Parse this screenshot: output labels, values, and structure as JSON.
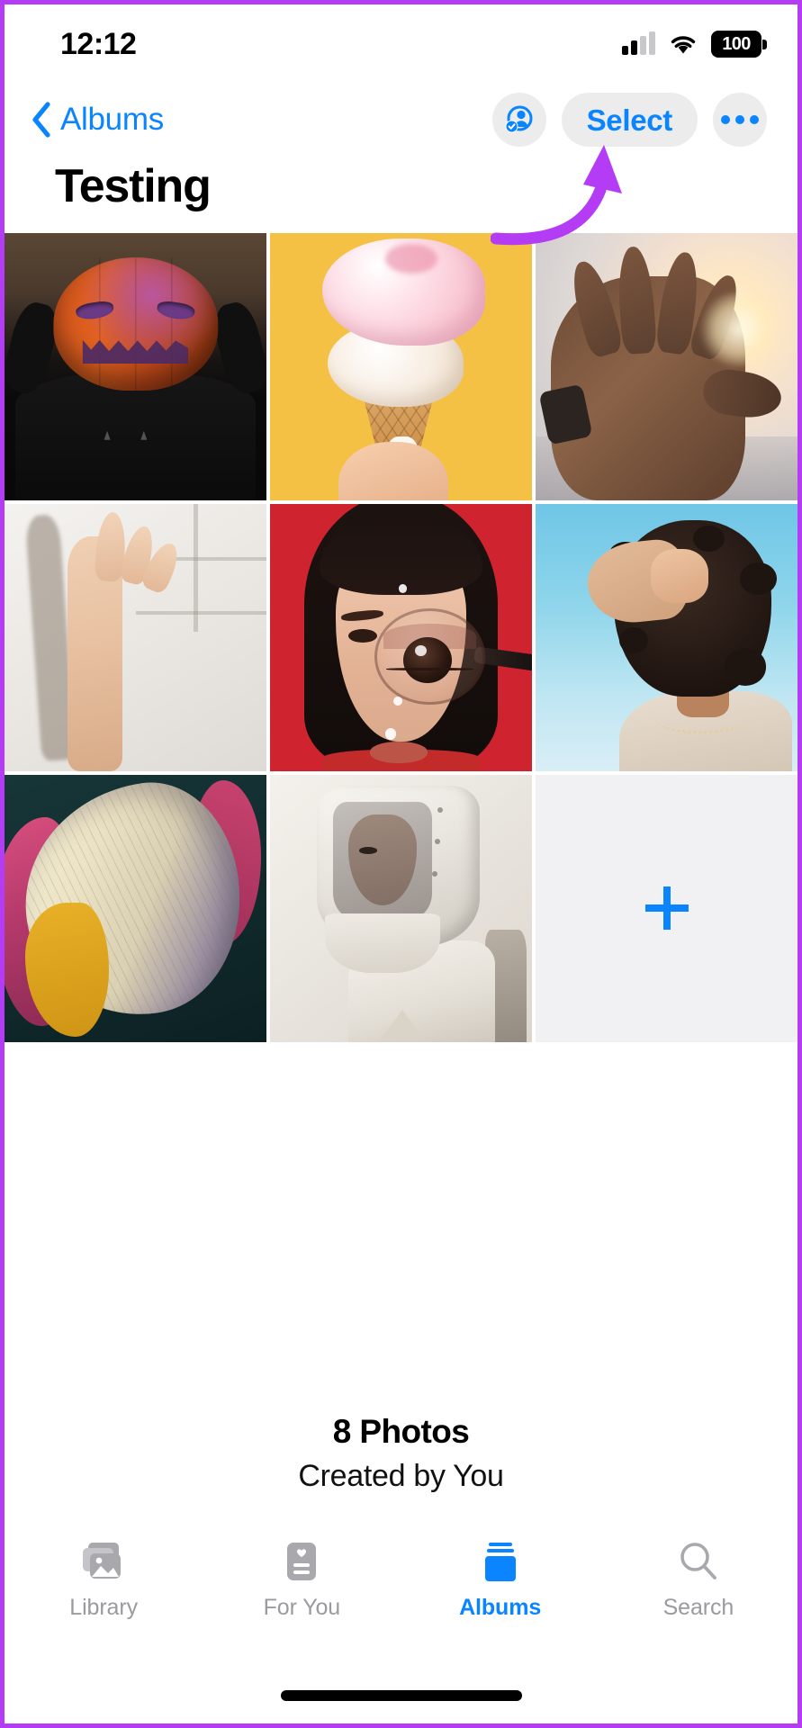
{
  "status_bar": {
    "time": "12:12",
    "battery_level": "100",
    "cellular_icon": "cellular-bars-icon",
    "wifi_icon": "wifi-icon",
    "battery_icon": "battery-full-icon"
  },
  "nav_bar": {
    "back_label": "Albums",
    "back_icon": "chevron-left-icon",
    "people_button_icon": "shared-album-people-icon",
    "select_label": "Select",
    "more_icon": "ellipsis-icon"
  },
  "page_title": "Testing",
  "grid": {
    "add_icon": "plus-icon",
    "photos": [
      {
        "name": "photo-pumpkin-head",
        "alt": "Person with carved pumpkin on head"
      },
      {
        "name": "photo-ice-cream-cone",
        "alt": "Hand holding pink ice cream cone on yellow background"
      },
      {
        "name": "photo-hand-sunset",
        "alt": "Hand reaching toward sun over water"
      },
      {
        "name": "photo-hand-shadow-wall",
        "alt": "Raised hand casting shadow on white wall"
      },
      {
        "name": "photo-eye-magnifier",
        "alt": "Woman's face with magnifying glass over eye on red background"
      },
      {
        "name": "photo-curly-hair-woman",
        "alt": "Woman with curly hair on light blue background"
      },
      {
        "name": "photo-flower-petal",
        "alt": "Close-up of cream and magenta flower petal"
      },
      {
        "name": "photo-astronaut-helmet",
        "alt": "Person in astronaut helmet backlit by sun"
      }
    ]
  },
  "footer": {
    "photo_count": "8 Photos",
    "created_by": "Created by You"
  },
  "tab_bar": {
    "tabs": [
      {
        "label": "Library",
        "icon": "photo-stack-icon",
        "active": false
      },
      {
        "label": "For You",
        "icon": "for-you-card-icon",
        "active": false
      },
      {
        "label": "Albums",
        "icon": "albums-books-icon",
        "active": true
      },
      {
        "label": "Search",
        "icon": "magnifying-glass-icon",
        "active": false
      }
    ]
  },
  "annotation": {
    "arrow_icon": "curved-arrow-annotation",
    "arrow_color": "#b43cf5",
    "frame_color": "#b43cf5"
  },
  "colors": {
    "accent_blue": "#0a84ff",
    "button_gray": "#ececed",
    "tab_inactive": "#9a9a9f",
    "add_tile_bg": "#f1f1f4"
  }
}
